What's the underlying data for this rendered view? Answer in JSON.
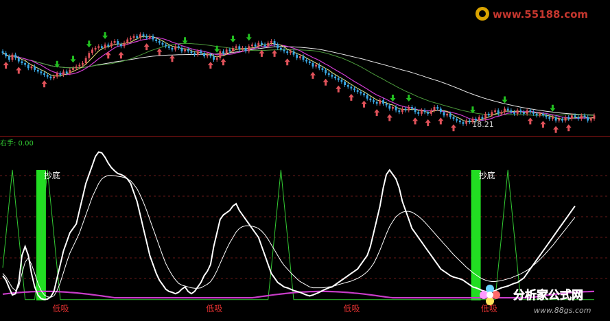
{
  "watermarks": {
    "top": "www.55188.com",
    "bottom_brand": "分析家公式网",
    "bottom_url": "www.88gs.com"
  },
  "colors": {
    "background": "#000000",
    "candle_up": "#e0525a",
    "candle_down": "#39a9e6",
    "arrow_up": "#e0525a",
    "arrow_down": "#22c020",
    "ma_white": "#e8e8e8",
    "ma_magenta": "#d23cd2",
    "ma_green": "#4c9a3c",
    "ma_yellow": "#ece87a",
    "osc_white": "#ffffff",
    "osc_magenta": "#c83cc8",
    "osc_green": "#33cc33",
    "signal_bar": "#22dd22",
    "separator": "#a01818",
    "grid": "#6a1a1a",
    "label_red": "#e03030",
    "indicator_label": "#33cc33"
  },
  "price_panel": {
    "low_marker": "18.21",
    "low_index": 146
  },
  "indicator_panel": {
    "label": "右手: 0.00",
    "buy_signals": [
      {
        "text": "抄底",
        "index": 12
      },
      {
        "text": "抄底",
        "index": 148
      }
    ],
    "low_labels": [
      {
        "text": "低吸",
        "index": 16
      },
      {
        "text": "低吸",
        "index": 64
      },
      {
        "text": "低吸",
        "index": 107
      },
      {
        "text": "低吸",
        "index": 150
      }
    ]
  },
  "chart_data": [
    {
      "type": "candlestick",
      "title": "",
      "candles_close": [
        22.5,
        22.3,
        22.1,
        22.4,
        22.2,
        22.0,
        21.9,
        21.8,
        21.6,
        21.7,
        21.5,
        21.4,
        21.3,
        21.2,
        21.1,
        21.0,
        21.1,
        21.3,
        21.2,
        21.4,
        21.3,
        21.5,
        21.6,
        21.7,
        21.8,
        21.9,
        22.2,
        22.5,
        22.7,
        22.8,
        22.9,
        22.8,
        23.0,
        22.9,
        23.1,
        23.2,
        23.0,
        22.9,
        23.1,
        23.3,
        23.4,
        23.5,
        23.4,
        23.6,
        23.5,
        23.4,
        23.5,
        23.3,
        23.2,
        23.1,
        23.0,
        22.9,
        22.8,
        22.7,
        22.9,
        22.8,
        22.6,
        22.7,
        22.6,
        22.5,
        22.4,
        22.6,
        22.5,
        22.3,
        22.4,
        22.3,
        22.1,
        22.2,
        22.6,
        22.5,
        22.7,
        22.6,
        22.8,
        22.9,
        22.7,
        22.8,
        22.6,
        22.9,
        23.0,
        22.9,
        23.1,
        23.0,
        22.9,
        23.1,
        23.2,
        23.0,
        22.8,
        22.7,
        22.6,
        22.5,
        22.6,
        22.4,
        22.2,
        22.3,
        22.1,
        22.0,
        21.9,
        21.7,
        21.8,
        21.6,
        21.5,
        21.3,
        21.2,
        21.1,
        21.0,
        20.9,
        20.8,
        20.6,
        20.5,
        20.4,
        20.3,
        20.2,
        20.1,
        20.0,
        19.8,
        19.7,
        19.6,
        19.5,
        19.7,
        19.5,
        19.4,
        19.2,
        19.3,
        19.1,
        19.0,
        19.2,
        19.1,
        19.3,
        19.2,
        19.0,
        18.9,
        19.1,
        19.0,
        18.9,
        19.1,
        19.3,
        19.2,
        19.0,
        18.8,
        18.9,
        18.7,
        18.6,
        18.5,
        18.4,
        18.3,
        18.5,
        18.4,
        18.6,
        18.5,
        18.7,
        18.6,
        18.9,
        18.8,
        19.0,
        19.1,
        18.9,
        19.0,
        19.2,
        19.1,
        19.0,
        18.9,
        19.1,
        19.0,
        18.9,
        19.1,
        19.0,
        18.9,
        18.8,
        18.9,
        18.8,
        18.7,
        18.6,
        18.7,
        18.5,
        18.6,
        18.5,
        18.7,
        18.6,
        18.8,
        18.7,
        18.6,
        18.8,
        18.7,
        18.5,
        18.6,
        18.8
      ]
    },
    {
      "type": "line",
      "title": "",
      "series": [
        {
          "values": [
            55,
            45,
            28,
            12,
            15,
            40,
            100,
            120,
            100,
            60,
            30,
            12,
            4,
            2,
            3,
            8,
            20,
            50,
            80,
            110,
            130,
            150,
            160,
            170,
            200,
            230,
            260,
            280,
            300,
            320,
            330,
            328,
            318,
            305,
            295,
            288,
            282,
            280,
            276,
            270,
            260,
            240,
            220,
            190,
            160,
            130,
            100,
            80,
            60,
            45,
            35,
            25,
            20,
            18,
            15,
            18,
            25,
            30,
            20,
            15,
            20,
            30,
            40,
            55,
            65,
            80,
            120,
            150,
            180,
            190,
            195,
            200,
            210,
            215,
            200,
            190,
            180,
            170,
            160,
            150,
            140,
            120,
            100,
            80,
            60,
            50,
            40,
            35,
            30,
            28,
            25,
            22,
            20,
            18,
            15,
            12,
            10,
            12,
            15,
            18,
            22,
            25,
            28,
            30,
            35,
            40,
            45,
            50,
            55,
            60,
            65,
            70,
            80,
            90,
            100,
            120,
            150,
            180,
            210,
            250,
            280,
            290,
            280,
            270,
            250,
            220,
            200,
            180,
            160,
            150,
            140,
            130,
            120,
            110,
            100,
            90,
            80,
            70,
            65,
            60,
            55,
            52,
            50,
            48,
            45,
            40,
            35,
            30,
            28,
            25,
            22,
            20,
            18,
            20,
            22,
            25,
            28,
            30,
            32,
            35,
            38,
            40,
            45,
            50,
            60,
            70,
            80,
            90,
            100,
            110,
            120,
            130,
            140,
            150,
            160,
            170,
            180,
            190,
            200,
            210
          ]
        },
        {
          "values": [
            60,
            52,
            40,
            28,
            22,
            30,
            60,
            85,
            95,
            80,
            60,
            38,
            22,
            12,
            8,
            7,
            10,
            22,
            40,
            62,
            85,
            105,
            120,
            135,
            150,
            170,
            190,
            210,
            230,
            245,
            260,
            270,
            275,
            278,
            278,
            277,
            276,
            275,
            273,
            270,
            266,
            258,
            248,
            234,
            218,
            200,
            180,
            160,
            140,
            120,
            100,
            82,
            68,
            56,
            46,
            38,
            34,
            32,
            30,
            28,
            27,
            27,
            28,
            32,
            36,
            42,
            52,
            66,
            82,
            98,
            114,
            128,
            140,
            152,
            160,
            164,
            166,
            166,
            165,
            163,
            160,
            154,
            146,
            136,
            124,
            112,
            100,
            88,
            78,
            70,
            62,
            55,
            48,
            42,
            38,
            34,
            30,
            28,
            28,
            28,
            28,
            29,
            30,
            31,
            33,
            35,
            37,
            39,
            41,
            43,
            46,
            49,
            53,
            58,
            64,
            72,
            82,
            96,
            112,
            130,
            148,
            164,
            176,
            186,
            192,
            196,
            198,
            198,
            196,
            192,
            187,
            181,
            174,
            166,
            158,
            150,
            142,
            134,
            126,
            118,
            110,
            102,
            95,
            88,
            81,
            74,
            68,
            62,
            57,
            52,
            48,
            45,
            43,
            42,
            42,
            43,
            44,
            46,
            48,
            50,
            53,
            56,
            59,
            63,
            67,
            72,
            78,
            84,
            91,
            98,
            106,
            114,
            122,
            131,
            140,
            149,
            158,
            167,
            176,
            185
          ]
        }
      ]
    }
  ]
}
